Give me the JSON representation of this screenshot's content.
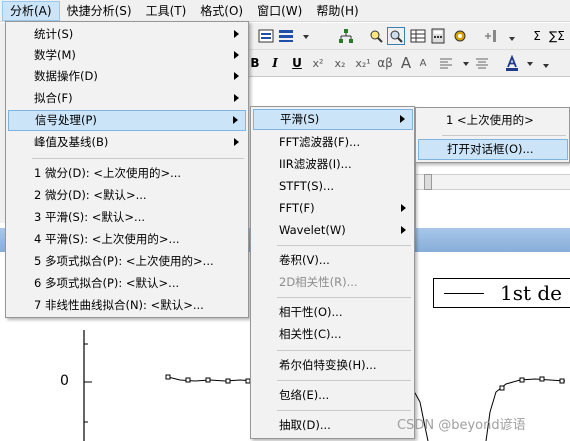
{
  "menubar": {
    "items": [
      "分析(A)",
      "快捷分析(S)",
      "工具(T)",
      "格式(O)",
      "窗口(W)",
      "帮助(H)"
    ]
  },
  "toolbar": {
    "row1": [
      "Σ",
      "∑Σ"
    ],
    "row2": [
      "B",
      "I",
      "U",
      "x²",
      "x₂",
      "x₂¹",
      "αβ",
      "A",
      "A"
    ]
  },
  "analysis_menu": {
    "items": [
      {
        "label": "统计(S)",
        "submenu": true
      },
      {
        "label": "数学(M)",
        "submenu": true
      },
      {
        "label": "数据操作(D)",
        "submenu": true
      },
      {
        "label": "拟合(F)",
        "submenu": true
      },
      {
        "label": "信号处理(P)",
        "submenu": true,
        "highlighted": true
      },
      {
        "label": "峰值及基线(B)",
        "submenu": true
      },
      {
        "label": "1 微分(D): <上次使用的>..."
      },
      {
        "label": "2 微分(D): <默认>..."
      },
      {
        "label": "3 平滑(S): <默认>..."
      },
      {
        "label": "4 平滑(S): <上次使用的>..."
      },
      {
        "label": "5 多项式拟合(P): <上次使用的>..."
      },
      {
        "label": "6 多项式拟合(P): <默认>..."
      },
      {
        "label": "7 非线性曲线拟合(N): <默认>..."
      }
    ]
  },
  "signal_menu": {
    "items": [
      {
        "label": "平滑(S)",
        "submenu": true,
        "highlighted": true
      },
      {
        "label": "FFT滤波器(F)..."
      },
      {
        "label": "IIR滤波器(I)..."
      },
      {
        "label": "STFT(S)..."
      },
      {
        "label": "FFT(F)",
        "submenu": true
      },
      {
        "label": "Wavelet(W)",
        "submenu": true
      },
      {
        "label": "卷积(V)..."
      },
      {
        "label": "2D相关性(R)...",
        "disabled": true
      },
      {
        "label": "相干性(O)..."
      },
      {
        "label": "相关性(C)..."
      },
      {
        "label": "希尔伯特变换(H)..."
      },
      {
        "label": "包络(E)..."
      },
      {
        "label": "抽取(D)..."
      }
    ]
  },
  "smooth_menu": {
    "items": [
      {
        "label": "1 <上次使用的>"
      },
      {
        "label": "打开对话框(O)...",
        "highlighted": true
      }
    ]
  },
  "graph": {
    "legend": "1st de",
    "y_tick": "0"
  },
  "watermark": "CSDN @beyond谚语",
  "colors": {
    "menu_highlight": "#cce4f7",
    "menu_border": "#979797",
    "graph_titlebar": "#a8c7ea"
  }
}
